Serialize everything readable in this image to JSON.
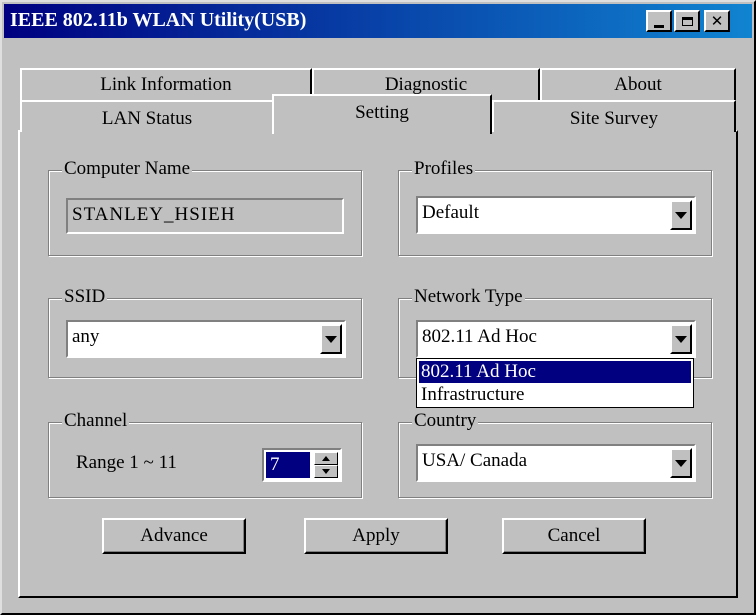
{
  "window": {
    "title": "IEEE 802.11b WLAN Utility(USB)",
    "controls": {
      "minimize": "_",
      "maximize": "□",
      "close": "✕"
    }
  },
  "tabs": {
    "row_back": [
      {
        "label": "Link Information"
      },
      {
        "label": "Diagnostic"
      },
      {
        "label": "About"
      }
    ],
    "row_front": [
      {
        "label": "LAN Status"
      },
      {
        "label": "Setting"
      },
      {
        "label": "Site Survey"
      }
    ],
    "active": "Setting"
  },
  "setting": {
    "computer_name": {
      "label": "Computer Name",
      "value": "STANLEY_HSIEH"
    },
    "profiles": {
      "label": "Profiles",
      "value": "Default"
    },
    "ssid": {
      "label": "SSID",
      "value": "any"
    },
    "network_type": {
      "label": "Network Type",
      "value": "802.11 Ad Hoc",
      "options": [
        "802.11 Ad Hoc",
        "Infrastructure"
      ],
      "highlighted": "802.11 Ad Hoc"
    },
    "channel": {
      "label": "Channel",
      "range_text": "Range 1 ~ 11",
      "value": "7"
    },
    "country": {
      "label": "Country",
      "value": "USA/ Canada"
    }
  },
  "buttons": {
    "advance": "Advance",
    "apply": "Apply",
    "cancel": "Cancel"
  }
}
